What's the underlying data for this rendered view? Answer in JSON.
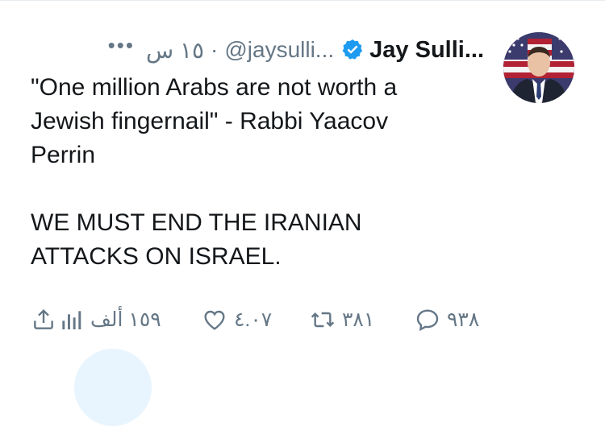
{
  "tweet": {
    "author_name": "Jay Sulli...",
    "handle": "@jaysulli...",
    "separator": "·",
    "time": "١٥ س",
    "more": "•••",
    "text": "\"One million Arabs are not worth a\nJewish fingernail\" - Rabbi Yaacov\nPerrin\n\nWE MUST END THE IRANIAN\nATTACKS ON ISRAEL.",
    "verified": true
  },
  "actions": {
    "reply_count": "٩٣٨",
    "retweet_count": "٣٨١",
    "like_count": "٤.٠٧",
    "views_count": "١٥٩ ألف"
  },
  "colors": {
    "text": "#14171a",
    "muted": "#657786",
    "verified_blue": "#1d9bf0",
    "avatar_flag_red": "#b22234",
    "avatar_flag_blue": "#3c3b6e"
  }
}
